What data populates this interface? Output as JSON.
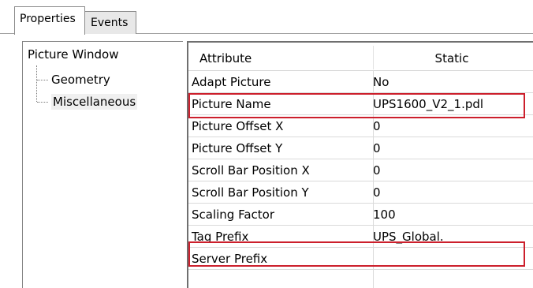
{
  "tabs": {
    "properties_label": "Properties",
    "events_label": "Events"
  },
  "tree": {
    "root_label": "Picture Window",
    "children": [
      {
        "label": "Geometry"
      },
      {
        "label": "Miscellaneous",
        "selected": true
      }
    ]
  },
  "grid": {
    "headers": {
      "attribute": "Attribute",
      "static": "Static"
    },
    "rows": [
      {
        "attribute": "Adapt Picture",
        "value": "No"
      },
      {
        "attribute": "Picture Name",
        "value": "UPS1600_V2_1.pdl",
        "highlighted": true
      },
      {
        "attribute": "Picture Offset X",
        "value": "0"
      },
      {
        "attribute": "Picture Offset Y",
        "value": "0"
      },
      {
        "attribute": "Scroll Bar Position X",
        "value": "0"
      },
      {
        "attribute": "Scroll Bar Position Y",
        "value": "0"
      },
      {
        "attribute": "Scaling Factor",
        "value": "100"
      },
      {
        "attribute": "Tag Prefix",
        "value": "UPS_Global.",
        "highlighted": true
      },
      {
        "attribute": "Server Prefix",
        "value": ""
      }
    ]
  },
  "colors": {
    "highlight_border": "#cc1f2c",
    "panel_border": "#6f6f6f"
  }
}
